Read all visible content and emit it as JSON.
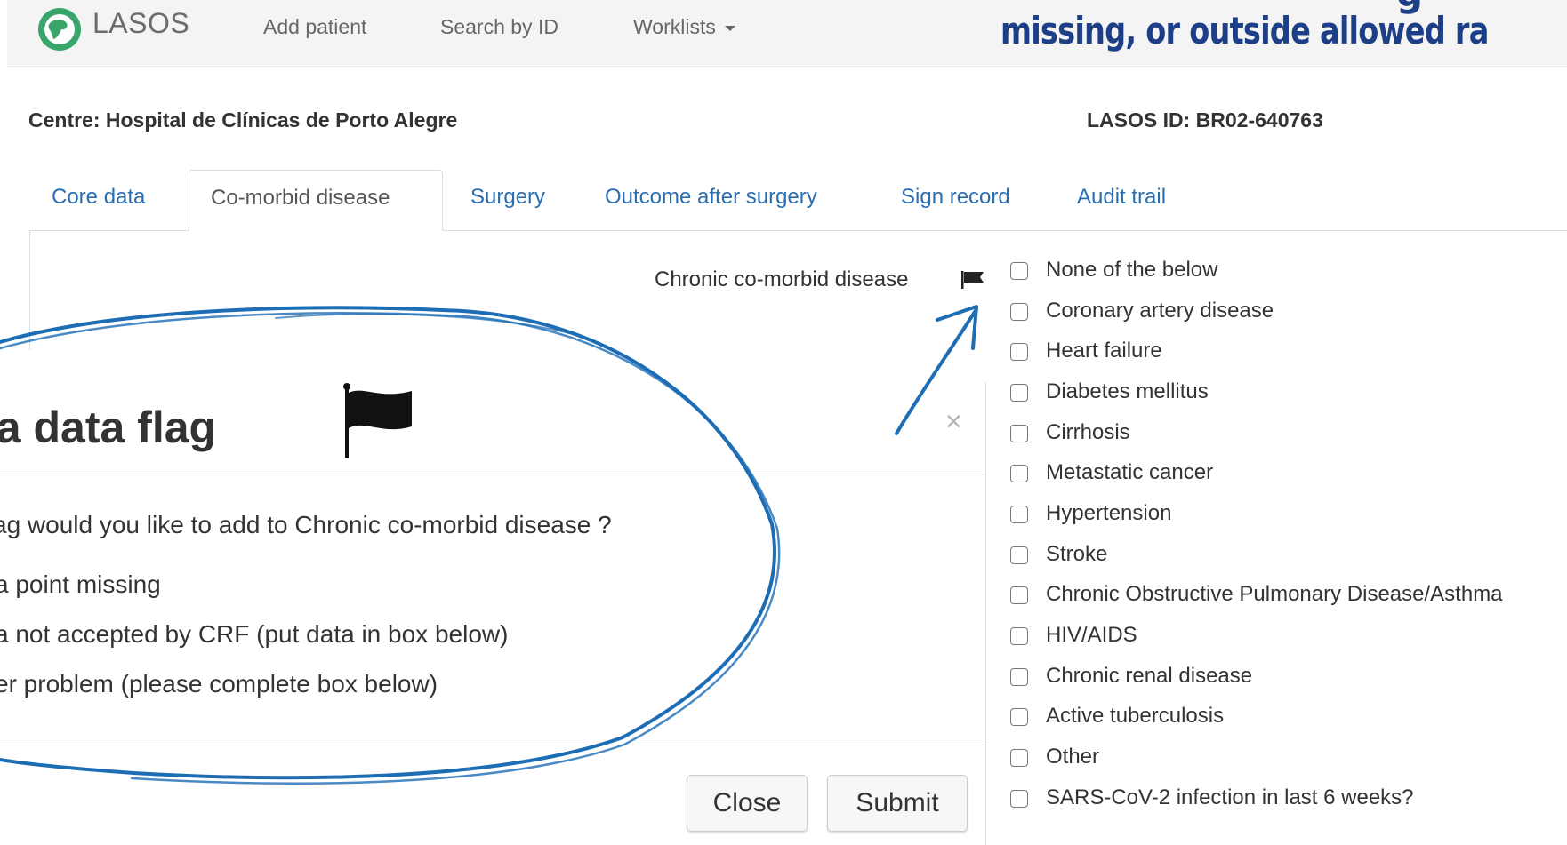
{
  "navbar": {
    "brand": "LASOS",
    "links": [
      "Add patient",
      "Search by ID",
      "Worklists"
    ],
    "headline": "missing, or outside allowed ra",
    "headline_partial_top": "g"
  },
  "info": {
    "centre": "Centre: Hospital de Clínicas de Porto Alegre",
    "lasos_id": "LASOS ID: BR02-640763"
  },
  "tabs": [
    {
      "label": "Core data",
      "active": false
    },
    {
      "label": "Co-morbid disease",
      "active": true
    },
    {
      "label": "Surgery",
      "active": false
    },
    {
      "label": "Outcome after surgery",
      "active": false
    },
    {
      "label": "Sign record",
      "active": false
    },
    {
      "label": "Audit trail",
      "active": false
    }
  ],
  "field": {
    "label": "Chronic co-morbid disease",
    "options": [
      "None of the below",
      "Coronary artery disease",
      "Heart failure",
      "Diabetes mellitus",
      "Cirrhosis",
      "Metastatic cancer",
      "Hypertension",
      "Stroke",
      "Chronic Obstructive Pulmonary Disease/Asthma",
      "HIV/AIDS",
      "Chronic renal disease",
      "Active tuberculosis",
      "Other",
      "SARS-CoV-2 infection in last 6 weeks?"
    ]
  },
  "modal": {
    "title": "l a data flag",
    "close_symbol": "×",
    "question": "ag would you like to add to Chronic co-morbid disease ?",
    "options": [
      "a point missing",
      "a not accepted by CRF (put data in box below)",
      "er problem (please complete box below)"
    ],
    "close_label": "Close",
    "submit_label": "Submit"
  },
  "colors": {
    "link": "#2a6eb0",
    "annotation": "#1d6db5",
    "headline": "#1d3f88",
    "logo_green": "#3aa56a"
  }
}
